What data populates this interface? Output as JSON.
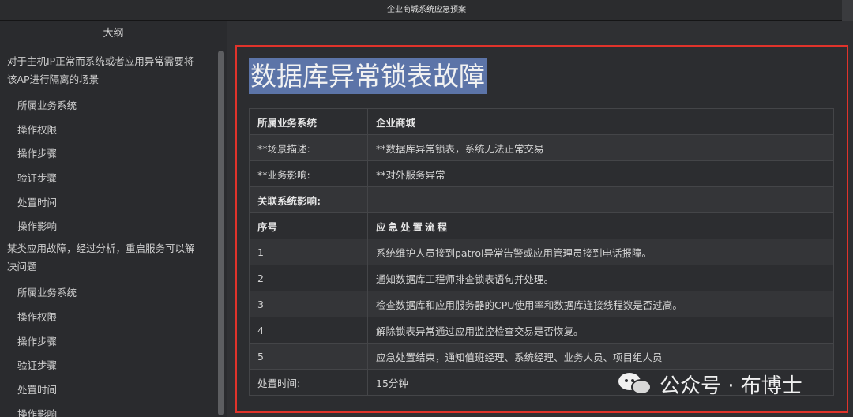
{
  "window": {
    "title": "企业商城系统应急预案"
  },
  "sidebar": {
    "title": "大纲",
    "items": [
      {
        "label": "对于主机IP正常而系统或者应用异常需要将该AP进行隔离的场景",
        "level": 1
      },
      {
        "label": "所属业务系统",
        "level": 2
      },
      {
        "label": "操作权限",
        "level": 2
      },
      {
        "label": "操作步骤",
        "level": 2
      },
      {
        "label": "验证步骤",
        "level": 2
      },
      {
        "label": "处置时间",
        "level": 2
      },
      {
        "label": "操作影响",
        "level": 2
      },
      {
        "label": "某类应用故障，经过分析，重启服务可以解决问题",
        "level": 1
      },
      {
        "label": "所属业务系统",
        "level": 2
      },
      {
        "label": "操作权限",
        "level": 2
      },
      {
        "label": "操作步骤",
        "level": 2
      },
      {
        "label": "验证步骤",
        "level": 2
      },
      {
        "label": "处置时间",
        "level": 2
      },
      {
        "label": "操作影响",
        "level": 2
      }
    ]
  },
  "document": {
    "title": "数据库异常锁表故障",
    "rows": [
      {
        "c1": "所属业务系统",
        "c2": "企业商城",
        "bold": true
      },
      {
        "c1": "**场景描述:",
        "c2": "**数据库异常锁表，系统无法正常交易",
        "bold": false
      },
      {
        "c1": "**业务影响:",
        "c2": "**对外服务异常",
        "bold": false
      },
      {
        "c1": "关联系统影响:",
        "c2": "",
        "bold": true
      },
      {
        "c1": "序号",
        "c2": "应急处置流程",
        "bold": true
      },
      {
        "c1": "1",
        "c2": "系统维护人员接到patrol异常告警或应用管理员接到电话报障。",
        "bold": false
      },
      {
        "c1": "2",
        "c2": "通知数据库工程师排查锁表语句并处理。",
        "bold": false
      },
      {
        "c1": "3",
        "c2": "检查数据库和应用服务器的CPU使用率和数据库连接线程数是否过高。",
        "bold": false
      },
      {
        "c1": "4",
        "c2": "解除锁表异常通过应用监控检查交易是否恢复。",
        "bold": false
      },
      {
        "c1": "5",
        "c2": "应急处置结束，通知值班经理、系统经理、业务人员、项目组人员",
        "bold": false
      },
      {
        "c1": "处置时间:",
        "c2": "15分钟",
        "bold": false
      }
    ]
  },
  "watermark": {
    "text": "公众号 · 布博士"
  },
  "colors": {
    "highlight_border": "#e0332b",
    "title_selection": "#5c74a8"
  }
}
